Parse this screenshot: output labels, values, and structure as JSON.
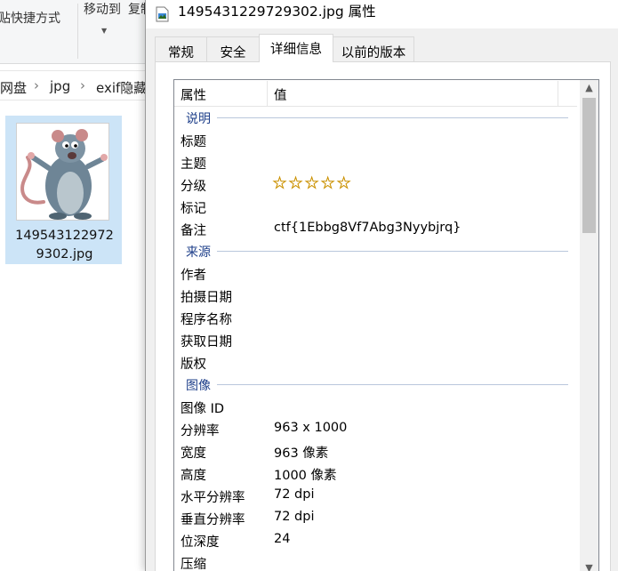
{
  "explorer": {
    "ribbon": {
      "paste_shortcut": "贴快捷方式",
      "move_to": "移动到",
      "copy_to_partial": "复制"
    },
    "breadcrumb": [
      "网盘",
      "jpg",
      "exif隐藏"
    ],
    "file": {
      "name_line1": "149543122972",
      "name_line2": "9302.jpg"
    }
  },
  "dialog": {
    "title": "1495431229729302.jpg 属性",
    "tabs": [
      "常规",
      "安全",
      "详细信息",
      "以前的版本"
    ],
    "active_tab": "详细信息",
    "header": {
      "property": "属性",
      "value": "值"
    },
    "groups": [
      {
        "label": "说明",
        "rows": [
          {
            "key": "标题",
            "value": ""
          },
          {
            "key": "主题",
            "value": ""
          },
          {
            "key": "分级",
            "value": "☆☆☆☆☆",
            "is_rating": true,
            "rating": 0
          },
          {
            "key": "标记",
            "value": ""
          },
          {
            "key": "备注",
            "value": "ctf{1Ebbg8Vf7Abg3Nyybjrq}"
          }
        ]
      },
      {
        "label": "来源",
        "rows": [
          {
            "key": "作者",
            "value": ""
          },
          {
            "key": "拍摄日期",
            "value": ""
          },
          {
            "key": "程序名称",
            "value": ""
          },
          {
            "key": "获取日期",
            "value": ""
          },
          {
            "key": "版权",
            "value": ""
          }
        ]
      },
      {
        "label": "图像",
        "rows": [
          {
            "key": "图像 ID",
            "value": ""
          },
          {
            "key": "分辨率",
            "value": "963 x 1000"
          },
          {
            "key": "宽度",
            "value": "963 像素"
          },
          {
            "key": "高度",
            "value": "1000 像素"
          },
          {
            "key": "水平分辨率",
            "value": "72 dpi"
          },
          {
            "key": "垂直分辨率",
            "value": "72 dpi"
          },
          {
            "key": "位深度",
            "value": "24"
          },
          {
            "key": "压缩",
            "value": ""
          }
        ]
      }
    ],
    "scrollbar": {
      "up_icon": "▲",
      "down_icon": "▼"
    }
  },
  "colors": {
    "group_label": "#1e3f8a",
    "selection": "#cce4f7",
    "star_fill": "#f4c400"
  }
}
